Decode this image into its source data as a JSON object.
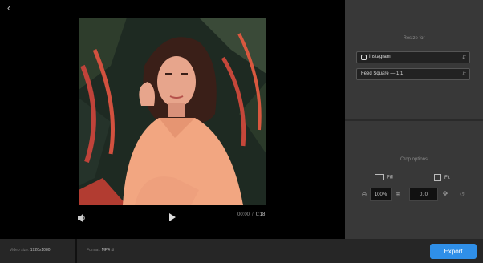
{
  "preview": {
    "time_current": "00:00",
    "time_total": "0:18"
  },
  "resize": {
    "title": "Resize for",
    "platform": "Instagram",
    "format": "Feed Square — 1:1"
  },
  "crop": {
    "title": "Crop options",
    "fill_label": "Fill",
    "fit_label": "Fit",
    "zoom": "100%",
    "position": "0, 0"
  },
  "bottom": {
    "size_label": "Video size:",
    "size_value": "1920x1080",
    "format_label": "Format:",
    "format_value": "MP4",
    "export_label": "Export"
  },
  "colors": {
    "accent": "#2f8fe8",
    "panel": "#383838",
    "bar": "#262626"
  }
}
